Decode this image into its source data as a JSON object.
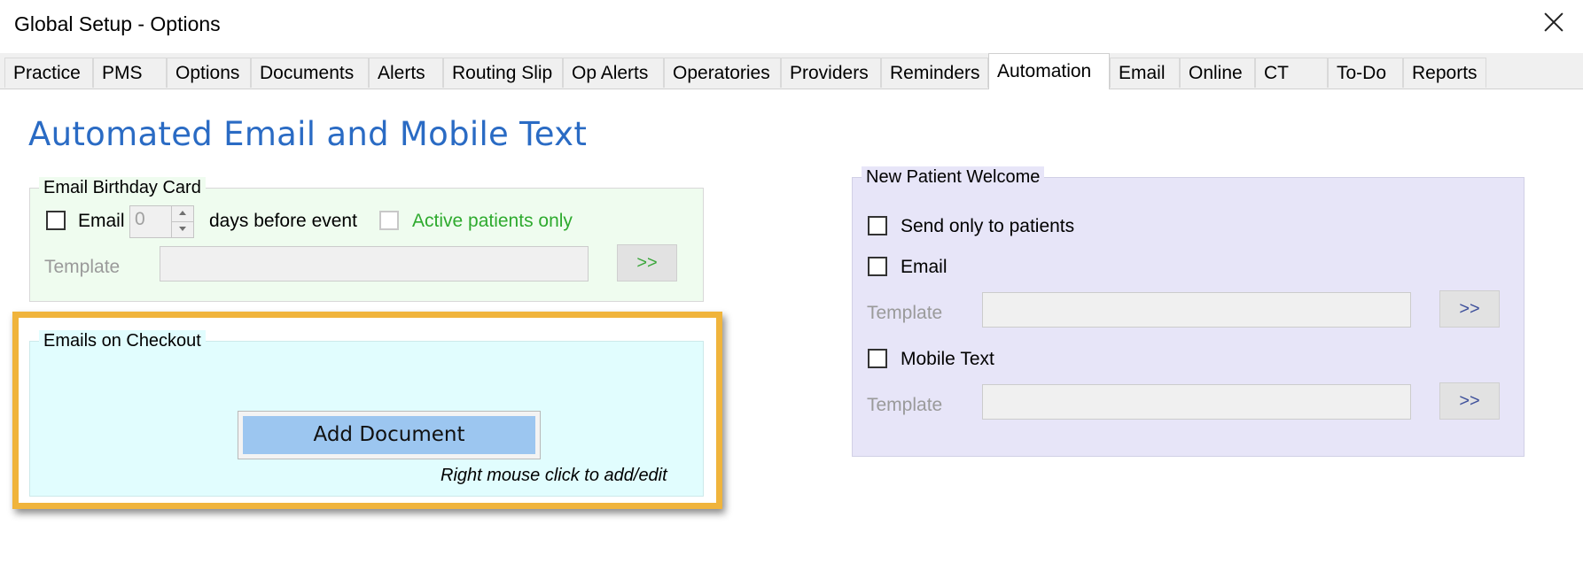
{
  "window": {
    "title": "Global Setup - Options"
  },
  "tabs": [
    {
      "label": "Practice"
    },
    {
      "label": "PMS"
    },
    {
      "label": "Options"
    },
    {
      "label": "Documents"
    },
    {
      "label": "Alerts"
    },
    {
      "label": "Routing Slip"
    },
    {
      "label": "Op Alerts"
    },
    {
      "label": "Operatories"
    },
    {
      "label": "Providers"
    },
    {
      "label": "Reminders"
    },
    {
      "label": "Automation"
    },
    {
      "label": "Email"
    },
    {
      "label": "Online"
    },
    {
      "label": "CT"
    },
    {
      "label": "To-Do"
    },
    {
      "label": "Reports"
    }
  ],
  "active_tab": "Automation",
  "heading": "Automated Email and Mobile Text",
  "birthday": {
    "title": "Email Birthday Card",
    "email_label": "Email",
    "email_checked": false,
    "days_value": "0",
    "days_label": "days before event",
    "active_label": "Active patients only",
    "template_label": "Template",
    "template_value": "",
    "browse_label": ">>"
  },
  "checkout": {
    "title": "Emails on Checkout",
    "add_label": "Add Document",
    "hint": "Right mouse click to add/edit"
  },
  "new_patient": {
    "title": "New Patient Welcome",
    "send_only_label": "Send only to patients",
    "email_label": "Email",
    "template_label": "Template",
    "browse_label": ">>",
    "mobile_label": "Mobile Text",
    "mobile_template_label": "Template",
    "mobile_browse_label": ">>"
  },
  "colors": {
    "heading": "#2a6bc4",
    "birthday_bg": "#effcef",
    "checkout_bg": "#e1fdfe",
    "new_patient_bg": "#e7e5f8",
    "highlight": "#f0b43c",
    "add_button": "#9cc6f0"
  },
  "icons": {
    "close": "close-icon",
    "spin_up": "chevron-up-icon",
    "spin_down": "chevron-down-icon"
  }
}
